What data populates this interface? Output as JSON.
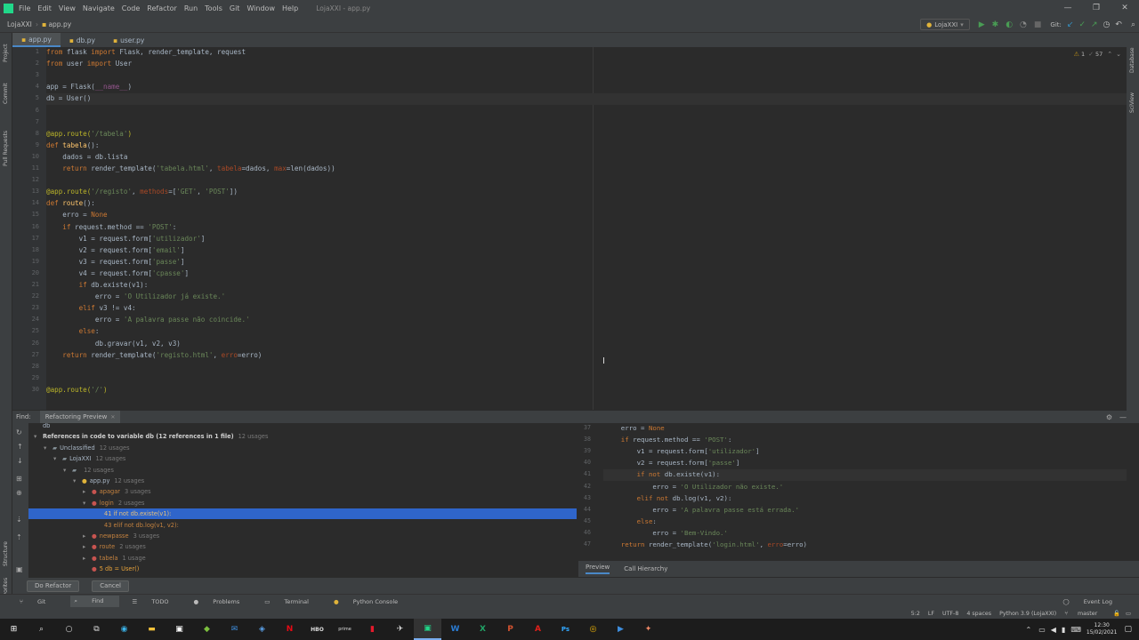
{
  "menu": [
    "File",
    "Edit",
    "View",
    "Navigate",
    "Code",
    "Refactor",
    "Run",
    "Tools",
    "Git",
    "Window",
    "Help"
  ],
  "window_title": "LojaXXI - app.py",
  "breadcrumb": {
    "project": "LojaXXI",
    "file": "app.py"
  },
  "run_config": "LojaXXI",
  "git_label": "Git:",
  "tabs": [
    "app.py",
    "db.py",
    "user.py"
  ],
  "inspections": {
    "warnings": "1",
    "weak_warnings": "57"
  },
  "editor": {
    "line_numbers": [
      "1",
      "2",
      "3",
      "4",
      "5",
      "6",
      "7",
      "8",
      "9",
      "10",
      "11",
      "12",
      "13",
      "14",
      "15",
      "16",
      "17",
      "18",
      "19",
      "20",
      "21",
      "22",
      "23",
      "24",
      "25",
      "26",
      "27",
      "28",
      "29",
      "30"
    ]
  },
  "code_lines": [
    [
      [
        "kw",
        "from "
      ],
      [
        "",
        "flask "
      ],
      [
        "kw",
        "import "
      ],
      [
        "",
        "Flask, render_template, request"
      ]
    ],
    [
      [
        "kw",
        "from "
      ],
      [
        "",
        "user "
      ],
      [
        "kw",
        "import "
      ],
      [
        "",
        "User"
      ]
    ],
    [],
    [
      [
        "",
        "app = Flask("
      ],
      [
        "sf",
        "__name__"
      ],
      [
        "",
        ")"
      ]
    ],
    [
      [
        "",
        "db = User()"
      ]
    ],
    [],
    [],
    [
      [
        "dec",
        "@app.route("
      ],
      [
        "st",
        "'/tabela'"
      ],
      [
        "dec",
        ")"
      ]
    ],
    [
      [
        "kw",
        "def "
      ],
      [
        "fn",
        "tabela"
      ],
      [
        "",
        "():"
      ]
    ],
    [
      [
        "",
        "    dados = db.lista"
      ]
    ],
    [
      [
        "kw",
        "    return "
      ],
      [
        "",
        "render_template("
      ],
      [
        "st",
        "'tabela.html'"
      ],
      [
        "",
        ", "
      ],
      [
        "nm",
        "tabela"
      ],
      [
        "",
        "=dados, "
      ],
      [
        "nm",
        "max"
      ],
      [
        "",
        "=len(dados))"
      ]
    ],
    [],
    [
      [
        "dec",
        "@app.route("
      ],
      [
        "st",
        "'/registo'"
      ],
      [
        "",
        ", "
      ],
      [
        "nm",
        "methods"
      ],
      [
        "",
        "=["
      ],
      [
        "st",
        "'GET'"
      ],
      [
        "",
        ", "
      ],
      [
        "st",
        "'POST'"
      ],
      [
        "",
        "])"
      ]
    ],
    [
      [
        "kw",
        "def "
      ],
      [
        "fn",
        "route"
      ],
      [
        "",
        "():"
      ]
    ],
    [
      [
        "",
        "    erro = "
      ],
      [
        "kw",
        "None"
      ]
    ],
    [
      [
        "kw",
        "    if "
      ],
      [
        "",
        "request.method == "
      ],
      [
        "st",
        "'POST'"
      ],
      [
        "",
        ":"
      ]
    ],
    [
      [
        "",
        "        v1 = request.form["
      ],
      [
        "st",
        "'utilizador'"
      ],
      [
        "",
        "]"
      ]
    ],
    [
      [
        "",
        "        v2 = request.form["
      ],
      [
        "st",
        "'email'"
      ],
      [
        "",
        "]"
      ]
    ],
    [
      [
        "",
        "        v3 = request.form["
      ],
      [
        "st",
        "'passe'"
      ],
      [
        "",
        "]"
      ]
    ],
    [
      [
        "",
        "        v4 = request.form["
      ],
      [
        "st",
        "'cpasse'"
      ],
      [
        "",
        "]"
      ]
    ],
    [
      [
        "kw",
        "        if "
      ],
      [
        "",
        "db.existe(v1):"
      ]
    ],
    [
      [
        "",
        "            erro = "
      ],
      [
        "st",
        "'O Utilizador já existe.'"
      ]
    ],
    [
      [
        "kw",
        "        elif "
      ],
      [
        "",
        "v3 != v4:"
      ]
    ],
    [
      [
        "",
        "            erro = "
      ],
      [
        "st",
        "'A palavra passe não coincide.'"
      ]
    ],
    [
      [
        "kw",
        "        else"
      ],
      [
        "",
        ":"
      ]
    ],
    [
      [
        "",
        "            db.gravar(v1, v2, v3)"
      ]
    ],
    [
      [
        "kw",
        "    return "
      ],
      [
        "",
        "render_template("
      ],
      [
        "st",
        "'registo.html'"
      ],
      [
        "",
        ", "
      ],
      [
        "nm",
        "erro"
      ],
      [
        "",
        "=erro)"
      ]
    ],
    [],
    [],
    [
      [
        "dec",
        "@app.route("
      ],
      [
        "st",
        "'/'"
      ],
      [
        "dec",
        ")"
      ]
    ]
  ],
  "find": {
    "label": "Find:",
    "tab": "Refactoring Preview",
    "tree": [
      {
        "text": "db",
        "count": "",
        "indent": 0
      },
      {
        "text": "References in code to variable db (12 references in 1 file)",
        "count": "12 usages",
        "indent": 0
      },
      {
        "text": "Unclassified",
        "count": "12 usages",
        "indent": 1
      },
      {
        "text": "LojaXXI",
        "count": "12 usages",
        "indent": 2
      },
      {
        "text": "",
        "count": "12 usages",
        "indent": 3
      },
      {
        "text": "app.py",
        "count": "12 usages",
        "indent": 4
      },
      {
        "text": "apagar",
        "count": "3 usages",
        "indent": 5
      },
      {
        "text": "login",
        "count": "2 usages",
        "indent": 5
      },
      {
        "text": "41 if not db.existe(v1):",
        "count": "",
        "indent": 6
      },
      {
        "text": "43 elif not db.log(v1, v2):",
        "count": "",
        "indent": 6
      },
      {
        "text": "newpasse",
        "count": "3 usages",
        "indent": 5
      },
      {
        "text": "route",
        "count": "2 usages",
        "indent": 5
      },
      {
        "text": "tabela",
        "count": "1 usage",
        "indent": 5
      },
      {
        "text": "5 db = User()",
        "count": "",
        "indent": 5
      }
    ],
    "preview_line_numbers": [
      "37",
      "38",
      "39",
      "40",
      "41",
      "42",
      "43",
      "44",
      "45",
      "46",
      "47"
    ],
    "preview_lines": [
      [
        [
          "",
          "    erro = "
        ],
        [
          "kw",
          "None"
        ]
      ],
      [
        [
          "kw",
          "    if "
        ],
        [
          "",
          "request.method == "
        ],
        [
          "st",
          "'POST'"
        ],
        [
          "",
          ":"
        ]
      ],
      [
        [
          "",
          "        v1 = request.form["
        ],
        [
          "st",
          "'utilizador'"
        ],
        [
          "",
          "]"
        ]
      ],
      [
        [
          "",
          "        v2 = request.form["
        ],
        [
          "st",
          "'passe'"
        ],
        [
          "",
          "]"
        ]
      ],
      [
        [
          "kw",
          "        if not "
        ],
        [
          "",
          "db.existe(v1):"
        ]
      ],
      [
        [
          "",
          "            erro = "
        ],
        [
          "st",
          "'O Utilizador não existe.'"
        ]
      ],
      [
        [
          "kw",
          "        elif not "
        ],
        [
          "",
          "db.log(v1, v2):"
        ]
      ],
      [
        [
          "",
          "            erro = "
        ],
        [
          "st",
          "'A palavra passe está errada.'"
        ]
      ],
      [
        [
          "kw",
          "        else"
        ],
        [
          "",
          ":"
        ]
      ],
      [
        [
          "",
          "            erro = "
        ],
        [
          "st",
          "'Bem-Vindo.'"
        ]
      ],
      [
        [
          "kw",
          "    return "
        ],
        [
          "",
          "render_template("
        ],
        [
          "st",
          "'login.html'"
        ],
        [
          "",
          ", "
        ],
        [
          "nm",
          "erro"
        ],
        [
          "",
          "=erro)"
        ]
      ]
    ],
    "preview_tabs": [
      "Preview",
      "Call Hierarchy"
    ],
    "do_refactor": "Do Refactor",
    "cancel": "Cancel"
  },
  "bottom_tools": [
    "Git",
    "Find",
    "TODO",
    "Problems",
    "Terminal",
    "Python Console"
  ],
  "event_log": "Event Log",
  "status": {
    "position": "5:2",
    "line_sep": "LF",
    "encoding": "UTF-8",
    "indent": "4 spaces",
    "interpreter": "Python 3.9 (LojaXXI)",
    "branch": "master"
  },
  "clock": {
    "time": "12:30",
    "date": "15/02/2021"
  }
}
